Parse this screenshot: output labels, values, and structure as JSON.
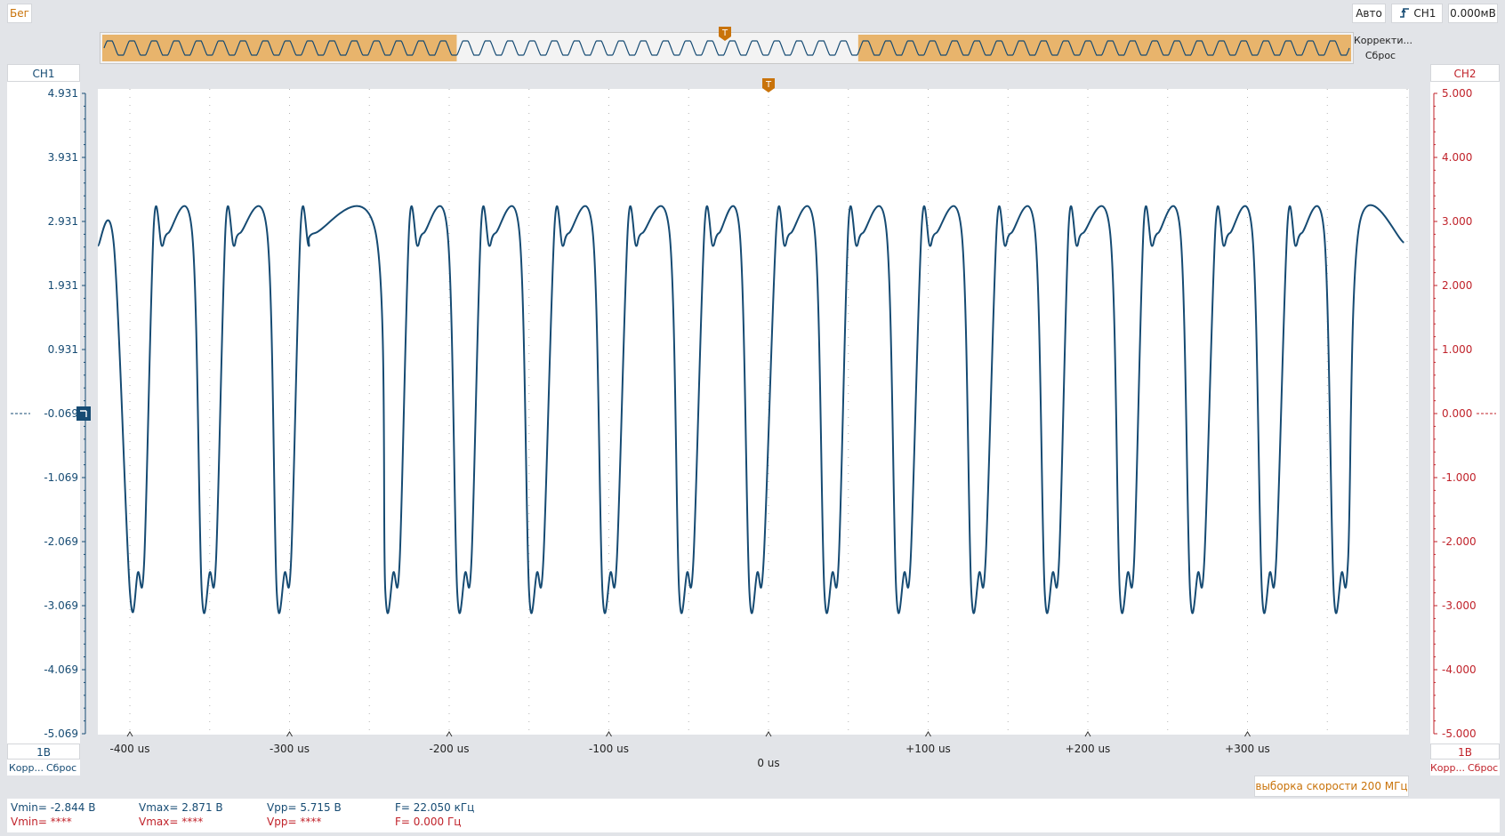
{
  "status": {
    "run_label": "Бег"
  },
  "top_right": {
    "mode_label": "Авто",
    "trigger_channel": "CH1",
    "trigger_level": "0.000мВ"
  },
  "overview": {
    "correct_label": "Корректи...",
    "reset_label": "Сброс",
    "visible_window": [
      0.283,
      0.605
    ]
  },
  "ch1": {
    "name": "CH1",
    "scale": "1В",
    "correct_label": "Корр...",
    "reset_label": "Сброс",
    "ticks": [
      "4.931",
      "3.931",
      "2.931",
      "1.931",
      "0.931",
      "-0.069",
      "-1.069",
      "-2.069",
      "-3.069",
      "-4.069",
      "-5.069"
    ]
  },
  "ch2": {
    "name": "CH2",
    "scale": "1В",
    "correct_label": "Корр...",
    "reset_label": "Сброс",
    "ticks": [
      "5.000",
      "4.000",
      "3.000",
      "2.000",
      "1.000",
      "0.000",
      "-1.000",
      "-2.000",
      "-3.000",
      "-4.000",
      "-5.000"
    ]
  },
  "x_axis": {
    "ticks": [
      "-400 us",
      "-300 us",
      "-200 us",
      "-100 us",
      "0 us",
      "+100 us",
      "+200 us",
      "+300 us"
    ]
  },
  "sample_rate_label": "выборка скорости 200 МГц",
  "measurements": {
    "ch1": {
      "vmin": "Vmin= -2.844 В",
      "vmax": "Vmax= 2.871 В",
      "vpp": "Vpp= 5.715 В",
      "freq": "F= 22.050 кГц"
    },
    "ch2": {
      "vmin": "Vmin= ****",
      "vmax": "Vmax= ****",
      "vpp": "Vpp= ****",
      "freq": "F= 0.000 Гц"
    }
  },
  "colors": {
    "ch1": "#164b73",
    "ch2": "#c0222a",
    "accent": "#c9730a",
    "overview_highlight": "#e8b46c"
  },
  "chart_data": {
    "type": "line",
    "x_unit": "us",
    "xlim": [
      -420,
      400
    ],
    "ylim": [
      -5.069,
      4.931
    ],
    "frequency_khz": 22.05,
    "vmin": -2.844,
    "vmax": 2.871,
    "series": [
      {
        "peaks_us": [
          -385,
          -340,
          -293,
          -225,
          -180,
          -134,
          -88,
          -40,
          5,
          50,
          96,
          143,
          188,
          235,
          280,
          325,
          370
        ],
        "troughs_us": [
          -400,
          -355,
          -308,
          -240,
          -195,
          -150,
          -104,
          -56,
          -12,
          35,
          80,
          127,
          173,
          220,
          264,
          309,
          354
        ]
      }
    ]
  }
}
